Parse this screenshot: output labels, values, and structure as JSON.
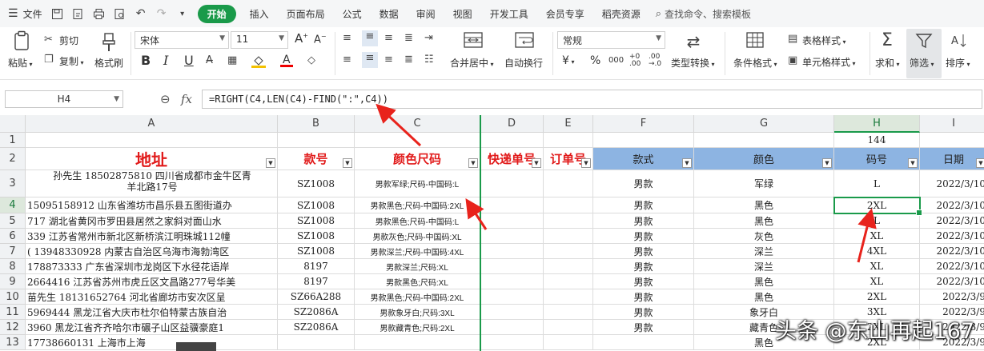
{
  "menubar": {
    "file": "文件",
    "tabs": [
      "开始",
      "插入",
      "页面布局",
      "公式",
      "数据",
      "审阅",
      "视图",
      "开发工具",
      "会员专享",
      "稻壳资源"
    ],
    "search_placeholder": "查找命令、搜索模板"
  },
  "ribbon": {
    "paste": "粘贴",
    "cut": "剪切",
    "copy": "复制",
    "format_painter": "格式刷",
    "font_name": "宋体",
    "font_size": "11",
    "merge_center": "合并居中",
    "wrap_text": "自动换行",
    "number_format": "常规",
    "type_convert": "类型转换",
    "conditional_format": "条件格式",
    "table_style": "表格样式",
    "cell_style": "单元格样式",
    "sum": "求和",
    "filter": "筛选",
    "sort": "排序",
    "bold": "B",
    "italic": "I",
    "underline": "U",
    "currency": "¥",
    "percent": "%"
  },
  "formula_bar": {
    "name_box": "H4",
    "fx": "fx",
    "formula": "=RIGHT(C4,LEN(C4)-FIND(\":\",C4))"
  },
  "sheet": {
    "columns": [
      "A",
      "B",
      "C",
      "D",
      "E",
      "F",
      "G",
      "H",
      "I"
    ],
    "rows": [
      "1",
      "2",
      "3",
      "4",
      "5",
      "6",
      "7",
      "8",
      "9",
      "10",
      "11",
      "12",
      "13"
    ],
    "h1": "144",
    "headers": {
      "a": "地址",
      "b": "款号",
      "c": "颜色尺码",
      "d": "快递单号",
      "e": "订单号",
      "f": "款式",
      "g": "颜色",
      "h": "码号",
      "i": "日期"
    },
    "data": [
      {
        "a": "孙先生  18502875810   四川省成都市金牛区青",
        "a2": "羊北路17号",
        "b": "SZ1008",
        "c": "男款军绿;尺码-中国码:L",
        "f": "男款",
        "g": "军绿",
        "h": "L",
        "i": "2022/3/10"
      },
      {
        "a": "15095158912   山东省潍坊市昌乐县五图街道办",
        "b": "SZ1008",
        "c": "男款黑色;尺码-中国码:2XL",
        "f": "男款",
        "g": "黑色",
        "h": "2XL",
        "i": "2022/3/10"
      },
      {
        "a": "717   湖北省黄冈市罗田县居然之家斜对面山水",
        "b": "SZ1008",
        "c": "男款黑色;尺码-中国码:L",
        "f": "男款",
        "g": "黑色",
        "h": "L",
        "i": "2022/3/10"
      },
      {
        "a": "339   江苏省常州市新北区新桥滨江明珠城112幢",
        "b": "SZ1008",
        "c": "男款灰色;尺码-中国码:XL",
        "f": "男款",
        "g": "灰色",
        "h": "XL",
        "i": "2022/3/10"
      },
      {
        "a": "( 13948330928    内蒙古自治区乌海市海勃湾区",
        "b": "SZ1008",
        "c": "男款深兰;尺码-中国码:4XL",
        "f": "男款",
        "g": "深兰",
        "h": "4XL",
        "i": "2022/3/10"
      },
      {
        "a": "178873333   广东省深圳市龙岗区下水径花语岸",
        "b": "8197",
        "c": "男款深兰;尺码:XL",
        "f": "男款",
        "g": "深兰",
        "h": "XL",
        "i": "2022/3/10"
      },
      {
        "a": "2664416   江苏省苏州市虎丘区文昌路277号华美",
        "b": "8197",
        "c": "男款黑色;尺码:XL",
        "f": "男款",
        "g": "黑色",
        "h": "XL",
        "i": "2022/3/10"
      },
      {
        "a": "苗先生  18131652764   河北省廊坊市安次区呈",
        "b": "SZ66A288",
        "c": "男款黑色;尺码-中国码:2XL",
        "f": "男款",
        "g": "黑色",
        "h": "2XL",
        "i": "2022/3/9"
      },
      {
        "a": "5969444   黑龙江省大庆市杜尔伯特蒙古族自治",
        "b": "SZ2086A",
        "c": "男款象牙白;尺码:3XL",
        "f": "男款",
        "g": "象牙白",
        "h": "3XL",
        "i": "2022/3/9"
      },
      {
        "a": "3960   黑龙江省齐齐哈尔市碾子山区益骥豪庭1",
        "b": "SZ2086A",
        "c": "男款藏青色;尺码:2XL",
        "f": "男款",
        "g": "藏青色",
        "h": "2XL",
        "i": "2022/3/9"
      },
      {
        "a": "  17738660131    上海市上海",
        "b": "",
        "c": "",
        "f": "",
        "g": "黑色",
        "h": "2XL",
        "i": "2022/3/9"
      }
    ]
  },
  "watermark": "头条 @东山再起167",
  "colors": {
    "accent": "#1a9a4a",
    "header_red": "#e11a1a",
    "header_blue": "#8db4e2",
    "arrow_red": "#e8231c"
  }
}
